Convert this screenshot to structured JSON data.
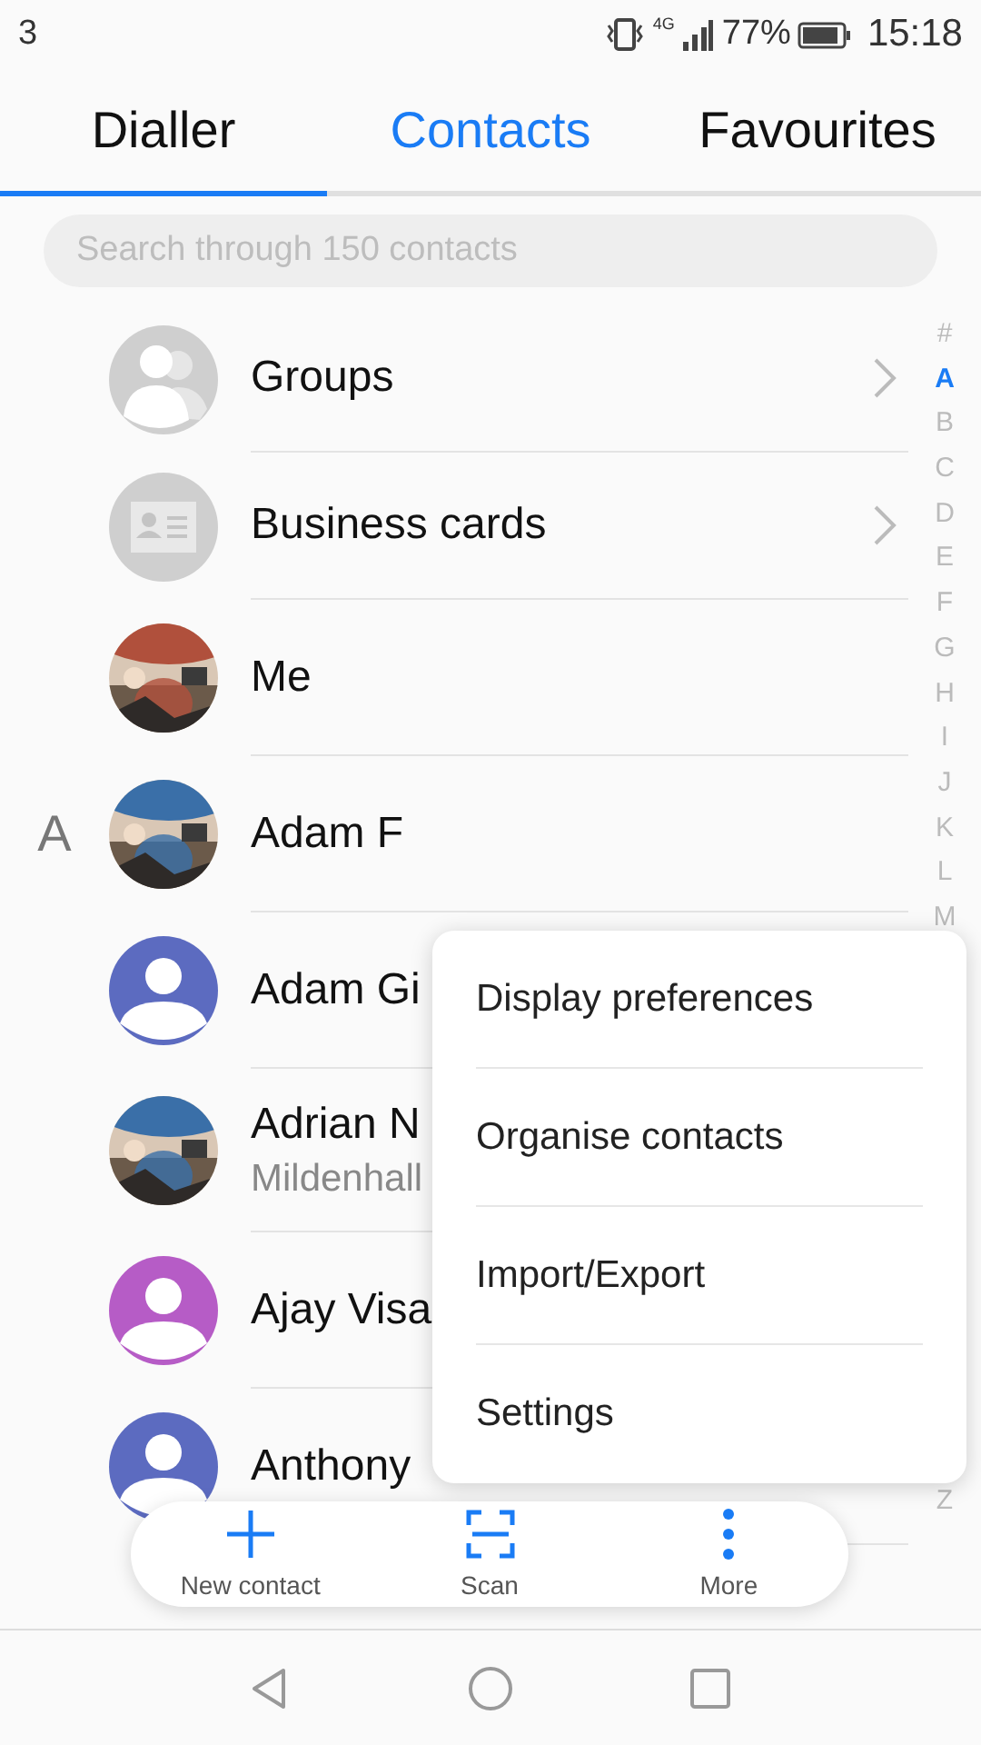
{
  "status_bar": {
    "carrier": "3",
    "network": "4G",
    "battery": "77%",
    "time": "15:18"
  },
  "tabs": [
    {
      "label": "Dialler",
      "selected": false,
      "underlined": true
    },
    {
      "label": "Contacts",
      "selected": true,
      "underlined": false
    },
    {
      "label": "Favourites",
      "selected": false,
      "underlined": false
    }
  ],
  "search": {
    "placeholder": "Search through 150 contacts"
  },
  "rows": [
    {
      "kind": "groups",
      "name": "Groups",
      "chevron": true
    },
    {
      "kind": "cards",
      "name": "Business cards",
      "chevron": true
    },
    {
      "name": "Me"
    },
    {
      "name": "Adam F",
      "section": "A"
    },
    {
      "kind": "silhouette",
      "name": "Adam Gi",
      "color": "#5c6bc0"
    },
    {
      "name": "Adrian N",
      "subtitle": "Mildenhall"
    },
    {
      "kind": "silhouette",
      "name": "Ajay Visa",
      "color": "#b65cc6"
    },
    {
      "kind": "silhouette",
      "name": "Anthony",
      "color": "#5c6bc0"
    }
  ],
  "index": [
    {
      "letter": "#",
      "selected": false
    },
    {
      "letter": "A",
      "selected": true
    },
    {
      "letter": "B",
      "selected": false
    },
    {
      "letter": "C",
      "selected": false
    },
    {
      "letter": "D",
      "selected": false
    },
    {
      "letter": "E",
      "selected": false
    },
    {
      "letter": "F",
      "selected": false
    },
    {
      "letter": "G",
      "selected": false
    },
    {
      "letter": "H",
      "selected": false
    },
    {
      "letter": "I",
      "selected": false
    },
    {
      "letter": "J",
      "selected": false
    },
    {
      "letter": "K",
      "selected": false
    },
    {
      "letter": "L",
      "selected": false
    },
    {
      "letter": "M",
      "selected": false
    },
    {
      "letter": "Z",
      "selected": false,
      "kind": "after-gap"
    }
  ],
  "menu": [
    "Display preferences",
    "Organise contacts",
    "Import/Export",
    "Settings"
  ],
  "toolbar": [
    {
      "kind": "add",
      "label": "New contact"
    },
    {
      "kind": "scan",
      "label": "Scan"
    },
    {
      "kind": "more",
      "label": "More"
    }
  ]
}
